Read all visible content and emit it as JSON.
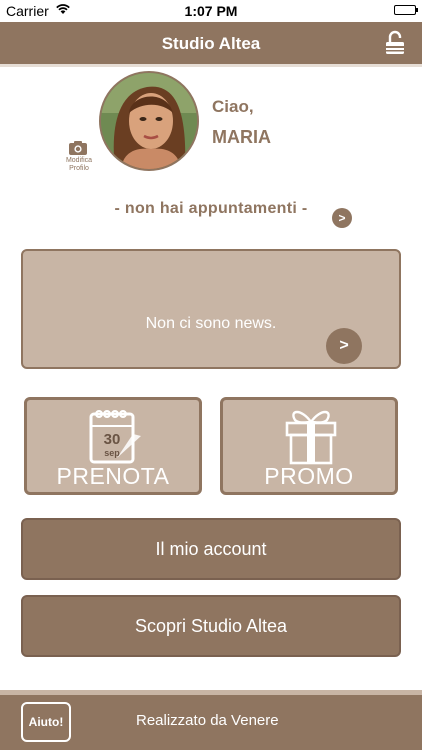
{
  "status_bar": {
    "carrier": "Carrier",
    "time": "1:07 PM"
  },
  "nav": {
    "title": "Studio Altea",
    "lock_icon": "unlock-icon"
  },
  "profile": {
    "edit_label": "Modifica Profilo",
    "greeting": "Ciao,",
    "name": "MARIA",
    "camera_icon": "camera-icon"
  },
  "appointments": {
    "text": "- non hai appuntamenti -",
    "arrow": ">"
  },
  "news": {
    "text": "Non ci sono news.",
    "arrow": ">"
  },
  "tiles": {
    "prenota": {
      "label": "PRENOTA",
      "icon": "calendar-icon",
      "calendar_day": "30",
      "calendar_month": "sep"
    },
    "promo": {
      "label": "PROMO",
      "icon": "gift-icon"
    }
  },
  "buttons": {
    "account": "Il mio account",
    "discover": "Scopri Studio Altea"
  },
  "footer": {
    "help": "Aiuto!",
    "credit": "Realizzato da Venere"
  },
  "colors": {
    "brand": "#8f7560",
    "panel": "#c8b5a5",
    "text_light": "#ffffff"
  }
}
